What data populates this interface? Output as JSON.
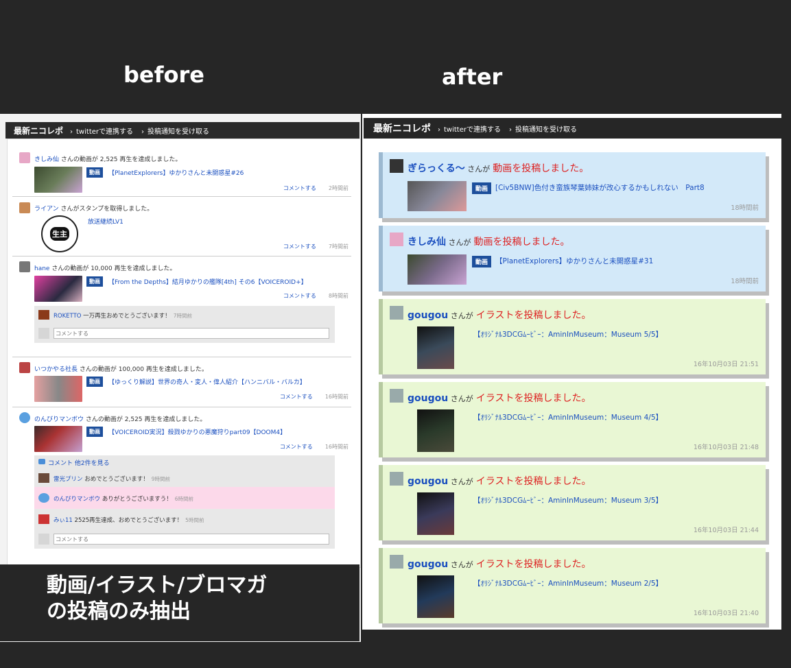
{
  "labels": {
    "before": "before",
    "after": "after"
  },
  "overlay": {
    "line1": "動画/イラスト/ブロマガ",
    "line2": "の投稿のみ抽出"
  },
  "header": {
    "title": "最新ニコレポ",
    "link1": "twitterで連携する",
    "link2": "投稿通知を受け取る"
  },
  "left": {
    "comment_label": "コメントする",
    "input_placeholder": "コメントする",
    "items": [
      {
        "user": "きしみ仙",
        "text": "さんの動画が 2,525 再生を達成しました。",
        "tag": "動画",
        "title": "【PlanetExplorers】ゆかりさんと未開惑星#26",
        "time": "2時間前"
      },
      {
        "user": "ライアン",
        "text": "さんがスタンプを取得しました。",
        "title": "放送継続LV1",
        "stamp": "生主",
        "time": "7時間前"
      },
      {
        "user": "hane",
        "text": "さんの動画が 10,000 再生を達成しました。",
        "tag": "動画",
        "title": "【From the Depths】結月ゆかりの艦隊[4th] その6【VOICEROID+】",
        "time": "8時間前",
        "comments": [
          {
            "user": "ROKETTO",
            "text": "一万再生おめでとうございます！",
            "time": "7時間前"
          }
        ]
      },
      {
        "user": "いつかやる社長",
        "text": "さんの動画が 100,000 再生を達成しました。",
        "tag": "動画",
        "title": "【ゆっくり解説】世界の奇人・変人・偉人紹介【ハンニバル・バルカ】",
        "time": "16時間前"
      },
      {
        "user": "のんびりマンボウ",
        "text": "さんの動画が 2,525 再生を達成しました。",
        "tag": "動画",
        "title": "【VOICEROID実況】殺戮ゆかりの悪魔狩りpart09【DOOM4】",
        "time": "16時間前",
        "more": "コメント 他2件を見る",
        "comments": [
          {
            "user": "雷光プリン",
            "text": "おめでとうございます！",
            "time": "9時間前"
          },
          {
            "user": "のんびりマンボウ",
            "text": "ありがとうございますう！",
            "time": "6時間前"
          },
          {
            "user": "みぃ11",
            "text": "2525再生達成、おめでとうございます！",
            "time": "5時間前"
          }
        ]
      }
    ]
  },
  "right": {
    "san_ga": "さんが",
    "items": [
      {
        "user": "ぎらっくる～",
        "action": "動画を投稿しました。",
        "tag": "動画",
        "title": "[Civ5BNW]色付き蛮族琴葉姉妹が改心するかもしれない　Part8",
        "time": "18時間前"
      },
      {
        "user": "きしみ仙",
        "action": "動画を投稿しました。",
        "tag": "動画",
        "title": "【PlanetExplorers】ゆかりさんと未開惑星#31",
        "time": "18時間前"
      },
      {
        "user": "gougou",
        "action": "イラストを投稿しました。",
        "title": "【ｵﾘｼﾞﾅﾙ3DCGﾑｰﾋﾞｰ：AminInMuseum：Museum 5/5】",
        "time": "16年10月03日 21:51"
      },
      {
        "user": "gougou",
        "action": "イラストを投稿しました。",
        "title": "【ｵﾘｼﾞﾅﾙ3DCGﾑｰﾋﾞｰ：AminInMuseum：Museum 4/5】",
        "time": "16年10月03日 21:48"
      },
      {
        "user": "gougou",
        "action": "イラストを投稿しました。",
        "title": "【ｵﾘｼﾞﾅﾙ3DCGﾑｰﾋﾞｰ：AminInMuseum：Museum 3/5】",
        "time": "16年10月03日 21:44"
      },
      {
        "user": "gougou",
        "action": "イラストを投稿しました。",
        "title": "【ｵﾘｼﾞﾅﾙ3DCGﾑｰﾋﾞｰ：AminInMuseum：Museum 2/5】",
        "time": "16年10月03日 21:40"
      }
    ]
  }
}
